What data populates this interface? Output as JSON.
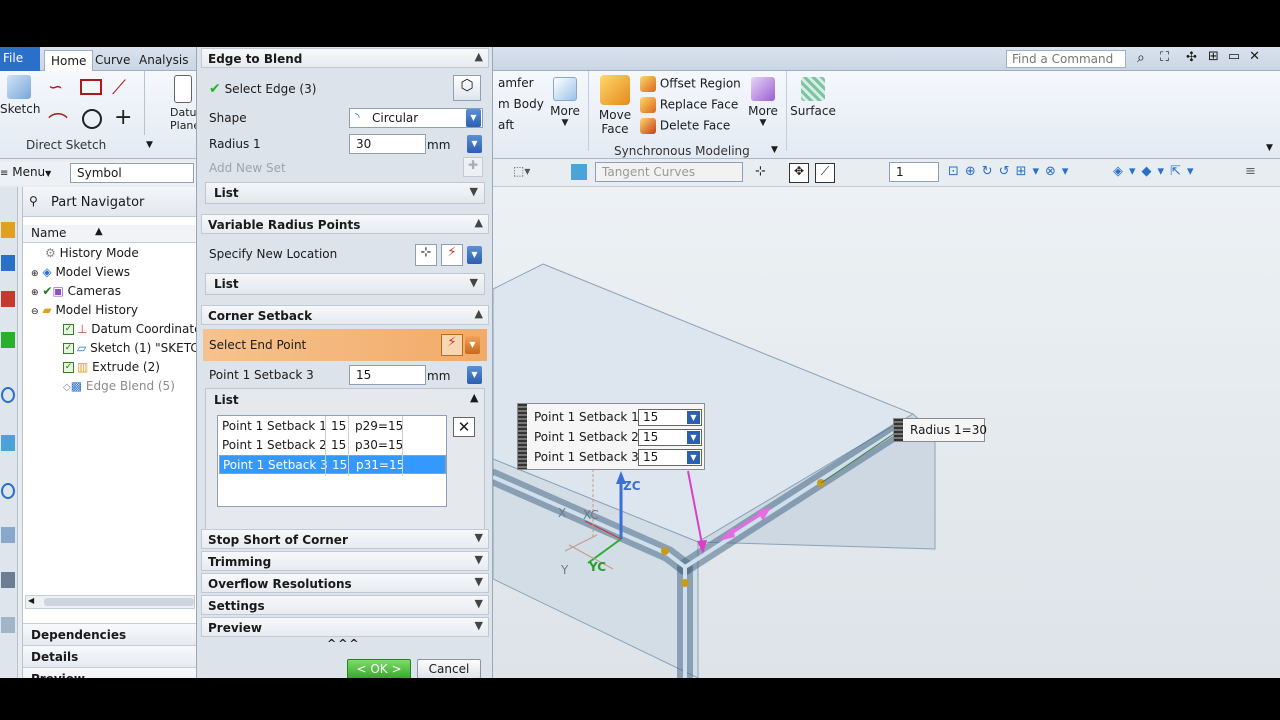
{
  "ribbon": {
    "tabs": [
      "File",
      "Home",
      "Curve",
      "Analysis"
    ],
    "groups": {
      "direct_sketch": {
        "label": "Direct Sketch",
        "sketch_label": "Sketch"
      },
      "datum_plane": {
        "label": "Datum Plane"
      },
      "feature": {
        "items": [
          "amfer",
          "m Body",
          "aft"
        ],
        "more": "More"
      },
      "sync": {
        "label": "Synchronous Modeling",
        "move_face": "Move Face",
        "offset_region": "Offset Region",
        "replace_face": "Replace Face",
        "delete_face": "Delete Face",
        "more": "More"
      },
      "surface": {
        "label": "Surface"
      }
    },
    "search_placeholder": "Find a Command"
  },
  "command_bar": {
    "menu_label": "Menu",
    "filter_value": "Symbol",
    "curve_rule": "Tangent Curves",
    "layer_value": "1"
  },
  "navigator": {
    "title": "Part Navigator",
    "column": "Name",
    "items": [
      {
        "label": "History Mode"
      },
      {
        "label": "Model Views"
      },
      {
        "label": "Cameras"
      },
      {
        "label": "Model History"
      },
      {
        "label": "Datum Coordinate"
      },
      {
        "label": "Sketch (1) \"SKETC"
      },
      {
        "label": "Extrude (2)"
      },
      {
        "label": "Edge Blend (5)"
      }
    ],
    "panels": [
      "Dependencies",
      "Details",
      "Preview"
    ]
  },
  "dialog": {
    "edge_to_blend": "Edge to Blend",
    "select_edge": "Select Edge (3)",
    "shape_label": "Shape",
    "shape_value": "Circular",
    "radius_label": "Radius 1",
    "radius_value": "30",
    "unit": "mm",
    "add_new_set": "Add New Set",
    "list_label": "List",
    "variable_radius": "Variable Radius Points",
    "specify_location": "Specify New Location",
    "corner_setback": "Corner Setback",
    "select_end_point": "Select End Point",
    "setback_label": "Point 1 Setback 3",
    "setback_value": "15",
    "setback_rows": [
      {
        "name": "Point 1 Setback 1",
        "value": "15",
        "expr": "p29=15"
      },
      {
        "name": "Point 1 Setback 2",
        "value": "15",
        "expr": "p30=15"
      },
      {
        "name": "Point 1 Setback 3",
        "value": "15",
        "expr": "p31=15"
      }
    ],
    "collapsed_sections": [
      "Stop Short of Corner",
      "Trimming",
      "Overflow Resolutions",
      "Settings",
      "Preview"
    ],
    "ok": "< OK >",
    "cancel": "Cancel"
  },
  "viewport": {
    "callout_rows": [
      {
        "label": "Point 1 Setback 1",
        "value": "15"
      },
      {
        "label": "Point 1 Setback 2",
        "value": "15"
      },
      {
        "label": "Point 1 Setback 3",
        "value": "15"
      }
    ],
    "radius_callout": "Radius 1=30",
    "axes": {
      "zc": "ZC",
      "xc": "XC",
      "yc": "YC",
      "x": "X",
      "y": "Y"
    }
  }
}
